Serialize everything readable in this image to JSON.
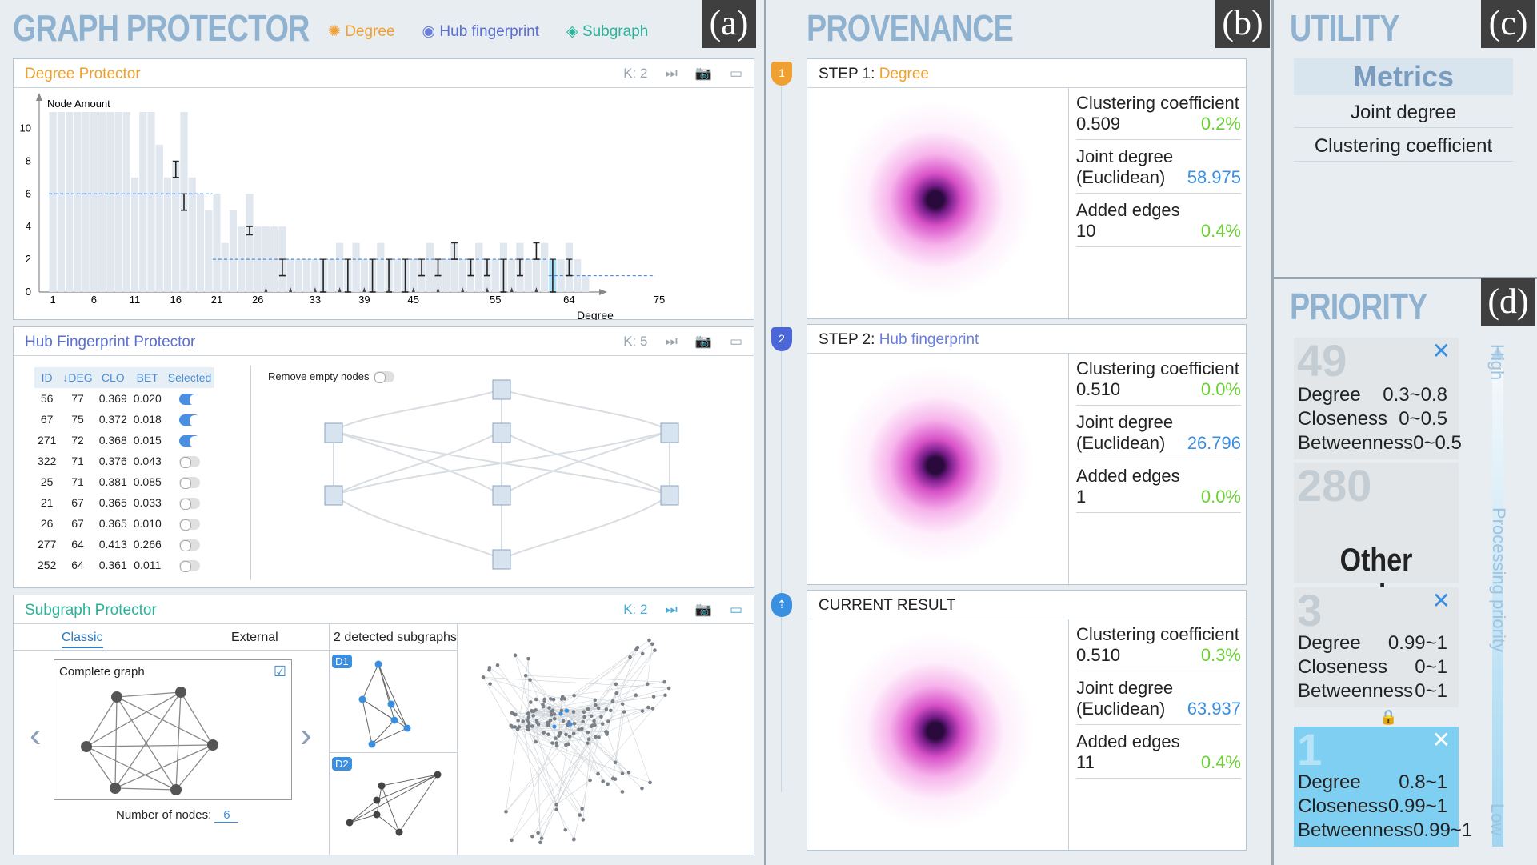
{
  "graph_protector": {
    "title": "GRAPH PROTECTOR",
    "letter": "(a)",
    "legend": [
      {
        "label": "Degree",
        "color": "#f0a030"
      },
      {
        "label": "Hub fingerprint",
        "color": "#6a7fd8"
      },
      {
        "label": "Subgraph",
        "color": "#2bb39a"
      }
    ]
  },
  "degree_panel": {
    "title": "Degree Protector",
    "k": "K: 2",
    "ylabel": "Node Amount",
    "xlabel": "Degree"
  },
  "chart_data": {
    "type": "bar",
    "title": "Degree Protector",
    "ylabel": "Node Amount",
    "xlabel": "Degree",
    "ylim": [
      0,
      11
    ],
    "yticks": [
      "0",
      "2",
      "4",
      "6",
      "8",
      "10"
    ],
    "xticks": [
      "1",
      "6",
      "11",
      "16",
      "21",
      "26",
      "33",
      "39",
      "45",
      "55",
      "64",
      "75"
    ],
    "values": [
      11,
      11,
      11,
      11,
      11,
      11,
      11,
      11,
      11,
      11,
      7,
      11,
      11,
      9,
      7,
      8,
      11,
      7,
      6,
      5,
      6,
      3,
      5,
      4,
      6,
      4,
      4,
      4,
      4,
      2,
      2,
      2,
      2,
      2,
      2,
      3,
      2,
      3,
      2,
      2,
      3,
      2,
      2,
      2,
      2,
      2,
      3,
      2,
      2,
      3,
      2,
      2,
      3,
      2,
      2,
      3,
      2,
      3,
      2,
      2,
      3,
      2,
      2,
      3,
      2,
      1
    ],
    "highlight_index": 61,
    "reference_lines": [
      {
        "value": 6,
        "from": "1",
        "to": "21"
      },
      {
        "value": 2,
        "from": "21",
        "to": "62"
      },
      {
        "value": 1,
        "from": "62",
        "to": "75"
      }
    ]
  },
  "hub_panel": {
    "title": "Hub Fingerprint Protector",
    "k": "K: 5",
    "remove_label": "Remove empty nodes",
    "headers": [
      "ID",
      "↓DEG",
      "CLO",
      "BET",
      "Selected"
    ],
    "rows": [
      [
        "56",
        "77",
        "0.369",
        "0.020",
        true
      ],
      [
        "67",
        "75",
        "0.372",
        "0.018",
        true
      ],
      [
        "271",
        "72",
        "0.368",
        "0.015",
        true
      ],
      [
        "322",
        "71",
        "0.376",
        "0.043",
        false
      ],
      [
        "25",
        "71",
        "0.381",
        "0.085",
        false
      ],
      [
        "21",
        "67",
        "0.365",
        "0.033",
        false
      ],
      [
        "26",
        "67",
        "0.365",
        "0.010",
        false
      ],
      [
        "277",
        "64",
        "0.413",
        "0.266",
        false
      ],
      [
        "252",
        "64",
        "0.361",
        "0.011",
        false
      ]
    ]
  },
  "subgraph_panel": {
    "title": "Subgraph Protector",
    "k": "K: 2",
    "tab_classic": "Classic",
    "tab_external": "External",
    "card_title": "Complete graph",
    "nodes_label": "Number of nodes:",
    "nodes_value": "6",
    "detected": "2 detected subgraphs",
    "d1": "D1",
    "d2": "D2"
  },
  "provenance": {
    "title": "PROVENANCE",
    "letter": "(b)",
    "steps": [
      {
        "badge": "1",
        "prefix": "STEP 1:",
        "name": "Degree",
        "name_color": "#f0a030",
        "cc": "0.509",
        "cc_pct": "0.2%",
        "jd": "58.975",
        "ae": "10",
        "ae_pct": "0.4%"
      },
      {
        "badge": "2",
        "prefix": "STEP 2:",
        "name": "Hub fingerprint",
        "name_color": "#6a7fd8",
        "cc": "0.510",
        "cc_pct": "0.0%",
        "jd": "26.796",
        "ae": "1",
        "ae_pct": "0.0%"
      },
      {
        "badge": "⇡",
        "prefix": "CURRENT  RESULT",
        "name": "",
        "name_color": "#222",
        "cc": "0.510",
        "cc_pct": "0.3%",
        "jd": "63.937",
        "ae": "11",
        "ae_pct": "0.4%"
      }
    ],
    "labels": {
      "cc": "Clustering coefficient",
      "jd1": "Joint degree",
      "jd2": "(Euclidean)",
      "ae": "Added edges"
    }
  },
  "utility": {
    "title": "UTILITY",
    "letter": "(c)",
    "header": "Metrics",
    "items": [
      "Joint degree",
      "Clustering coefficient"
    ]
  },
  "priority": {
    "title": "PRIORITY",
    "letter": "(d)",
    "high": "High",
    "low": "Low",
    "axis": "Processing priority",
    "cards": [
      {
        "num": "49",
        "rows": [
          [
            "Degree",
            "0.3~0.8"
          ],
          [
            "Closeness",
            "0~0.5"
          ],
          [
            "Betweenness",
            "0~0.5"
          ]
        ]
      },
      {
        "num": "280",
        "other": "Other nodes"
      },
      {
        "num": "3",
        "rows": [
          [
            "Degree",
            "0.99~1"
          ],
          [
            "Closeness",
            "0~1"
          ],
          [
            "Betweenness",
            "0~1"
          ]
        ]
      },
      {
        "num": "1",
        "rows": [
          [
            "Degree",
            "0.8~1"
          ],
          [
            "Closeness",
            "0.99~1"
          ],
          [
            "Betweenness",
            "0.99~1"
          ]
        ]
      }
    ]
  }
}
